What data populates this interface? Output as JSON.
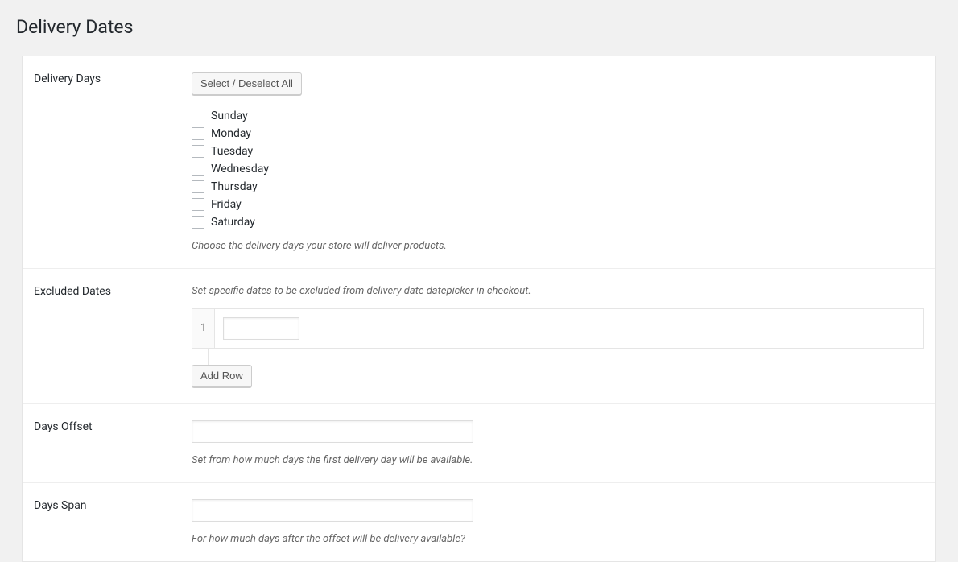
{
  "page": {
    "title": "Delivery Dates"
  },
  "deliveryDays": {
    "label": "Delivery Days",
    "selectAllButton": "Select / Deselect All",
    "days": [
      {
        "label": "Sunday"
      },
      {
        "label": "Monday"
      },
      {
        "label": "Tuesday"
      },
      {
        "label": "Wednesday"
      },
      {
        "label": "Thursday"
      },
      {
        "label": "Friday"
      },
      {
        "label": "Saturday"
      }
    ],
    "description": "Choose the delivery days your store will deliver products."
  },
  "excludedDates": {
    "label": "Excluded Dates",
    "description": "Set specific dates to be excluded from delivery date datepicker in checkout.",
    "rows": [
      {
        "number": "1",
        "value": ""
      }
    ],
    "addRowButton": "Add Row"
  },
  "daysOffset": {
    "label": "Days Offset",
    "value": "",
    "description": "Set from how much days the first delivery day will be available."
  },
  "daysSpan": {
    "label": "Days Span",
    "value": "",
    "description": "For how much days after the offset will be delivery available?"
  }
}
